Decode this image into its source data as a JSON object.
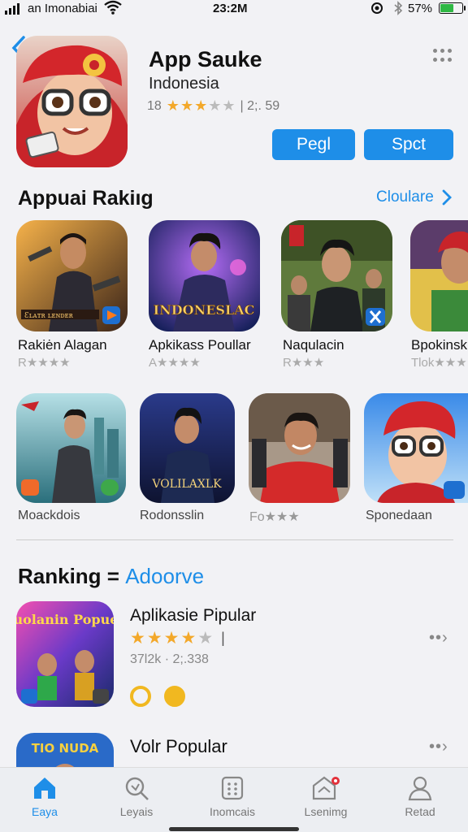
{
  "status_bar": {
    "carrier": "an Imonabiai",
    "time": "23:2M",
    "battery": "57%"
  },
  "header": {
    "title": "App Sauke",
    "subtitle": "Indonesia",
    "rating_count": "18",
    "meta": "| 2;. 59",
    "buttons": {
      "primary": "Pegl",
      "secondary": "Spct"
    }
  },
  "section1": {
    "title": "Appuai Rakiıg",
    "see_all": "Cloulare",
    "row1": [
      {
        "label": "Rakiėn Alagan",
        "rating": "R★★★★",
        "art": "Ɛʟᴀᴛʀ ʟᴇɴᴅᴇʀ"
      },
      {
        "label": "Apkikass Poullar",
        "rating": "A★★★★",
        "art": "INDONESLAC"
      },
      {
        "label": "Naqulacin",
        "rating": "R★★★"
      },
      {
        "label": "Bpokinsk",
        "rating": "Tlok★★★"
      }
    ],
    "row2": [
      {
        "label": "Moackdois"
      },
      {
        "label": "Rodonsslin",
        "art": "VOLILAXLK"
      },
      {
        "label": "Fo★★★"
      },
      {
        "label": "Sponedaan"
      }
    ]
  },
  "section2": {
    "title": "Ranking =",
    "title_accent": "Adoorve",
    "items": [
      {
        "name": "Aplikasie Pipular",
        "meta": "37l2k · 2;.338",
        "stars": 4,
        "art": "Suolanin Popuec"
      },
      {
        "name": "Volr Popular",
        "art": "TIO NUDA"
      }
    ]
  },
  "tabbar": [
    {
      "label": "Eaya",
      "icon": "home-icon",
      "active": true
    },
    {
      "label": "Leyais",
      "icon": "search-icon",
      "active": false
    },
    {
      "label": "Inomcais",
      "icon": "grid-icon",
      "active": false
    },
    {
      "label": "Lsenimg",
      "icon": "store-icon",
      "active": false
    },
    {
      "label": "Retad",
      "icon": "person-icon",
      "active": false
    }
  ],
  "colors": {
    "accent": "#1e8ee8",
    "star": "#f3a82a",
    "background": "#f2f2f5"
  }
}
